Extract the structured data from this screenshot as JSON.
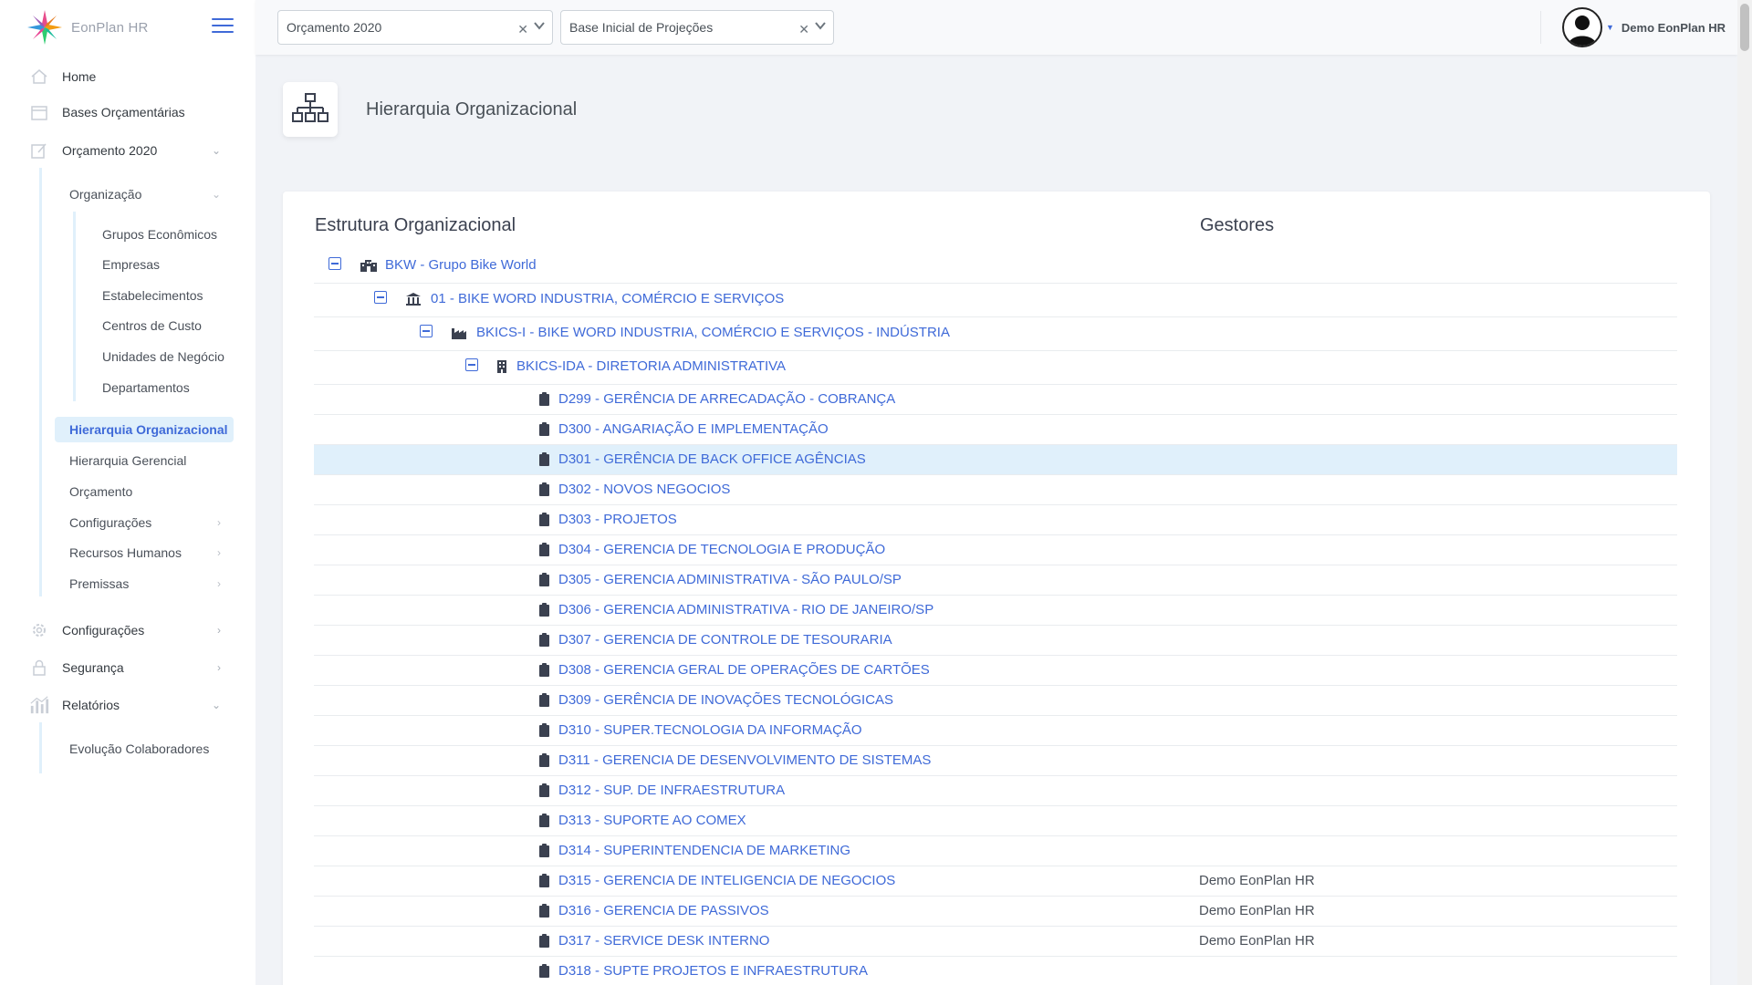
{
  "app": {
    "brand": "EonPlan HR"
  },
  "topbar": {
    "budget_select": "Orçamento 2020",
    "base_select": "Base Inicial de Projeções",
    "user_name": "Demo EonPlan HR"
  },
  "sidebar": {
    "items": [
      {
        "label": "Home",
        "icon": "home-icon"
      },
      {
        "label": "Bases Orçamentárias",
        "icon": "calendar-icon"
      },
      {
        "label": "Orçamento 2020",
        "icon": "edit-icon"
      },
      {
        "label": "Configurações",
        "icon": "gear-icon"
      },
      {
        "label": "Segurança",
        "icon": "lock-icon"
      },
      {
        "label": "Relatórios",
        "icon": "chart-icon"
      }
    ],
    "orcamento_sub": [
      {
        "label": "Organização"
      },
      {
        "label": "Hierarquia Organizacional"
      },
      {
        "label": "Hierarquia Gerencial"
      },
      {
        "label": "Orçamento"
      },
      {
        "label": "Configurações"
      },
      {
        "label": "Recursos Humanos"
      },
      {
        "label": "Premissas"
      }
    ],
    "organizacao_sub": [
      {
        "label": "Grupos Econômicos"
      },
      {
        "label": "Empresas"
      },
      {
        "label": "Estabelecimentos"
      },
      {
        "label": "Centros de Custo"
      },
      {
        "label": "Unidades de Negócio"
      },
      {
        "label": "Departamentos"
      }
    ],
    "relatorios_sub": [
      {
        "label": "Evolução Colaboradores"
      }
    ]
  },
  "page": {
    "title": "Hierarquia Organizacional"
  },
  "tree": {
    "col_structure": "Estrutura Organizacional",
    "col_managers": "Gestores",
    "rows": [
      {
        "label": "BKW - Grupo Bike World",
        "manager": ""
      },
      {
        "label": "01 - BIKE WORD INDUSTRIA, COMÉRCIO E SERVIÇOS",
        "manager": ""
      },
      {
        "label": "BKICS-I - BIKE WORD INDUSTRIA, COMÉRCIO E SERVIÇOS - INDÚSTRIA",
        "manager": ""
      },
      {
        "label": "BKICS-IDA - DIRETORIA ADMINISTRATIVA",
        "manager": ""
      },
      {
        "label": "D299 - GERÊNCIA DE ARRECADAÇÃO - COBRANÇA",
        "manager": ""
      },
      {
        "label": "D300 - ANGARIAÇÃO E IMPLEMENTAÇÃO",
        "manager": ""
      },
      {
        "label": "D301 - GERÊNCIA DE BACK OFFICE AGÊNCIAS",
        "manager": ""
      },
      {
        "label": "D302 - NOVOS NEGOCIOS",
        "manager": ""
      },
      {
        "label": "D303 - PROJETOS",
        "manager": ""
      },
      {
        "label": "D304 - GERENCIA DE TECNOLOGIA E PRODUÇÃO",
        "manager": ""
      },
      {
        "label": "D305 - GERENCIA ADMINISTRATIVA - SÃO PAULO/SP",
        "manager": ""
      },
      {
        "label": "D306 - GERENCIA ADMINISTRATIVA - RIO DE JANEIRO/SP",
        "manager": ""
      },
      {
        "label": "D307 - GERENCIA DE CONTROLE DE TESOURARIA",
        "manager": ""
      },
      {
        "label": "D308 - GERENCIA GERAL DE OPERAÇÕES DE CARTÕES",
        "manager": ""
      },
      {
        "label": "D309 - GERÊNCIA DE INOVAÇÕES TECNOLÓGICAS",
        "manager": ""
      },
      {
        "label": "D310 - SUPER.TECNOLOGIA DA INFORMAÇÃO",
        "manager": ""
      },
      {
        "label": "D311 - GERENCIA DE DESENVOLVIMENTO DE SISTEMAS",
        "manager": ""
      },
      {
        "label": "D312 - SUP. DE INFRAESTRUTURA",
        "manager": ""
      },
      {
        "label": "D313 - SUPORTE AO COMEX",
        "manager": ""
      },
      {
        "label": "D314 - SUPERINTENDENCIA DE MARKETING",
        "manager": ""
      },
      {
        "label": "D315 - GERENCIA DE INTELIGENCIA DE NEGOCIOS",
        "manager": "Demo EonPlan HR"
      },
      {
        "label": "D316 - GERENCIA DE PASSIVOS",
        "manager": "Demo EonPlan HR"
      },
      {
        "label": "D317 - SERVICE DESK INTERNO",
        "manager": "Demo EonPlan HR"
      },
      {
        "label": "D318 - SUPTE PROJETOS E INFRAESTRUTURA",
        "manager": ""
      }
    ]
  },
  "colors": {
    "accent": "#3f6ad8",
    "selected_row": "#e0f0fb"
  }
}
